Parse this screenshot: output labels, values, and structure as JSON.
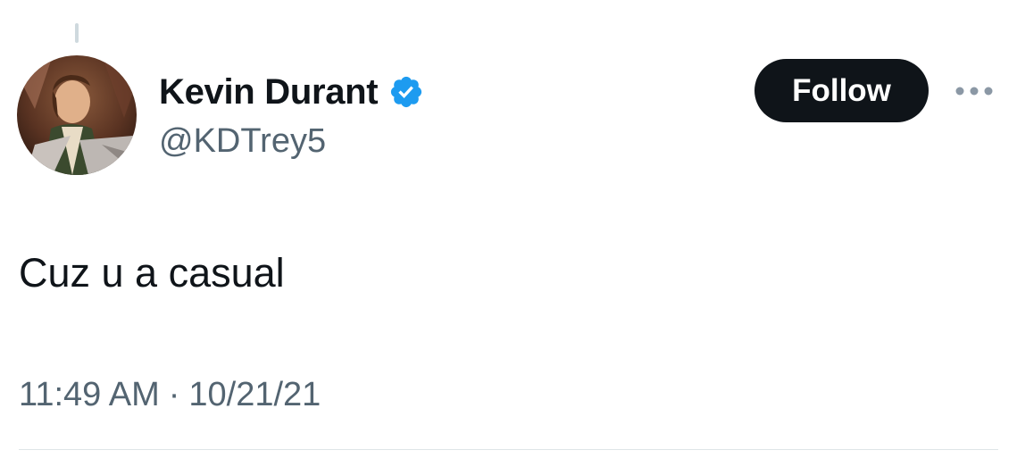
{
  "tweet": {
    "author": {
      "display_name": "Kevin Durant",
      "handle": "@KDTrey5",
      "verified": true,
      "verified_icon": "verified-badge-icon",
      "avatar_icon": "avatar"
    },
    "follow_label": "Follow",
    "more_icon": "more-options-icon",
    "text": "Cuz u a casual",
    "time": "11:49 AM",
    "separator": "·",
    "date": "10/21/21"
  },
  "colors": {
    "text_primary": "#0f1419",
    "text_secondary": "#536471",
    "verified_blue": "#1d9bf0",
    "button_bg": "#0f1419",
    "divider": "#dfe5e8"
  }
}
